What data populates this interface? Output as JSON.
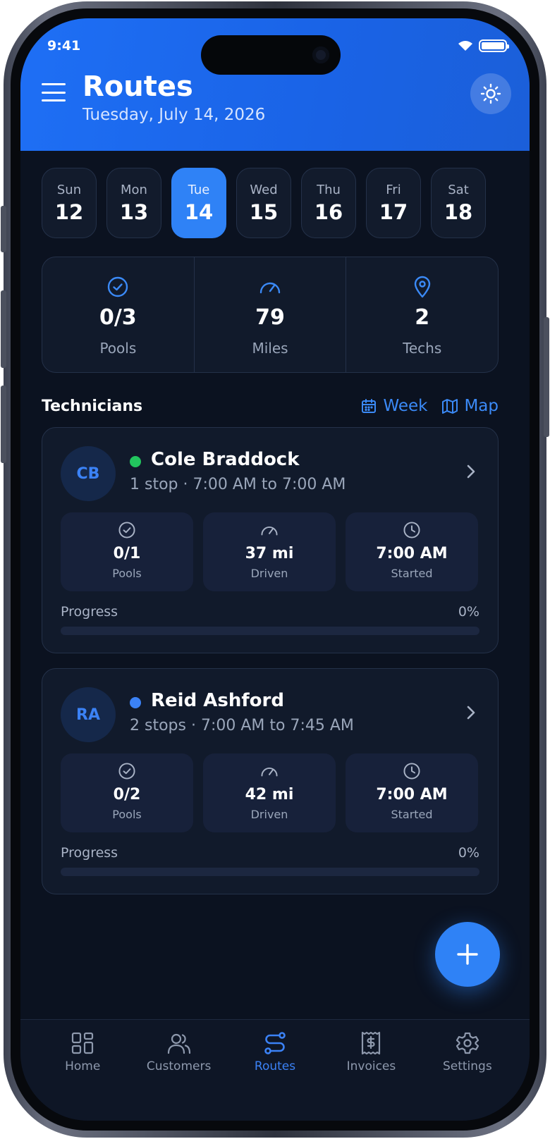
{
  "status": {
    "time": "9:41"
  },
  "header": {
    "title": "Routes",
    "date": "Tuesday, July 14, 2026"
  },
  "days": [
    {
      "name": "Sun",
      "num": "12"
    },
    {
      "name": "Mon",
      "num": "13"
    },
    {
      "name": "Tue",
      "num": "14"
    },
    {
      "name": "Wed",
      "num": "15"
    },
    {
      "name": "Thu",
      "num": "16"
    },
    {
      "name": "Fri",
      "num": "17"
    },
    {
      "name": "Sat",
      "num": "18"
    }
  ],
  "selected_day": "Tue",
  "stats": [
    {
      "value": "0/3",
      "label": "Pools",
      "icon": "check-circle-icon"
    },
    {
      "value": "79",
      "label": "Miles",
      "icon": "gauge-icon"
    },
    {
      "value": "2",
      "label": "Techs",
      "icon": "map-pin-icon"
    }
  ],
  "section": {
    "title": "Technicians",
    "week_label": "Week",
    "map_label": "Map"
  },
  "technicians": [
    {
      "initials": "CB",
      "name": "Cole Braddock",
      "status_color": "#22c55e",
      "meta": "1 stop · 7:00 AM to 7:00 AM",
      "pools": "0/1",
      "pools_label": "Pools",
      "driven": "37 mi",
      "driven_label": "Driven",
      "started": "7:00 AM",
      "started_label": "Started",
      "progress_label": "Progress",
      "progress_pct": "0%",
      "progress": 0
    },
    {
      "initials": "RA",
      "name": "Reid Ashford",
      "status_color": "#3b82f6",
      "meta": "2 stops · 7:00 AM to 7:45 AM",
      "pools": "0/2",
      "pools_label": "Pools",
      "driven": "42 mi",
      "driven_label": "Driven",
      "started": "7:00 AM",
      "started_label": "Started",
      "progress_label": "Progress",
      "progress_pct": "0%",
      "progress": 0
    }
  ],
  "tabs": [
    {
      "label": "Home",
      "icon": "grid-icon"
    },
    {
      "label": "Customers",
      "icon": "users-icon"
    },
    {
      "label": "Routes",
      "icon": "route-icon"
    },
    {
      "label": "Invoices",
      "icon": "receipt-icon"
    },
    {
      "label": "Settings",
      "icon": "gear-icon"
    }
  ],
  "active_tab": "Routes",
  "colors": {
    "accent": "#2f82f6",
    "header": "#1e6ff5",
    "background": "#0b1220",
    "card": "#111a2b"
  }
}
